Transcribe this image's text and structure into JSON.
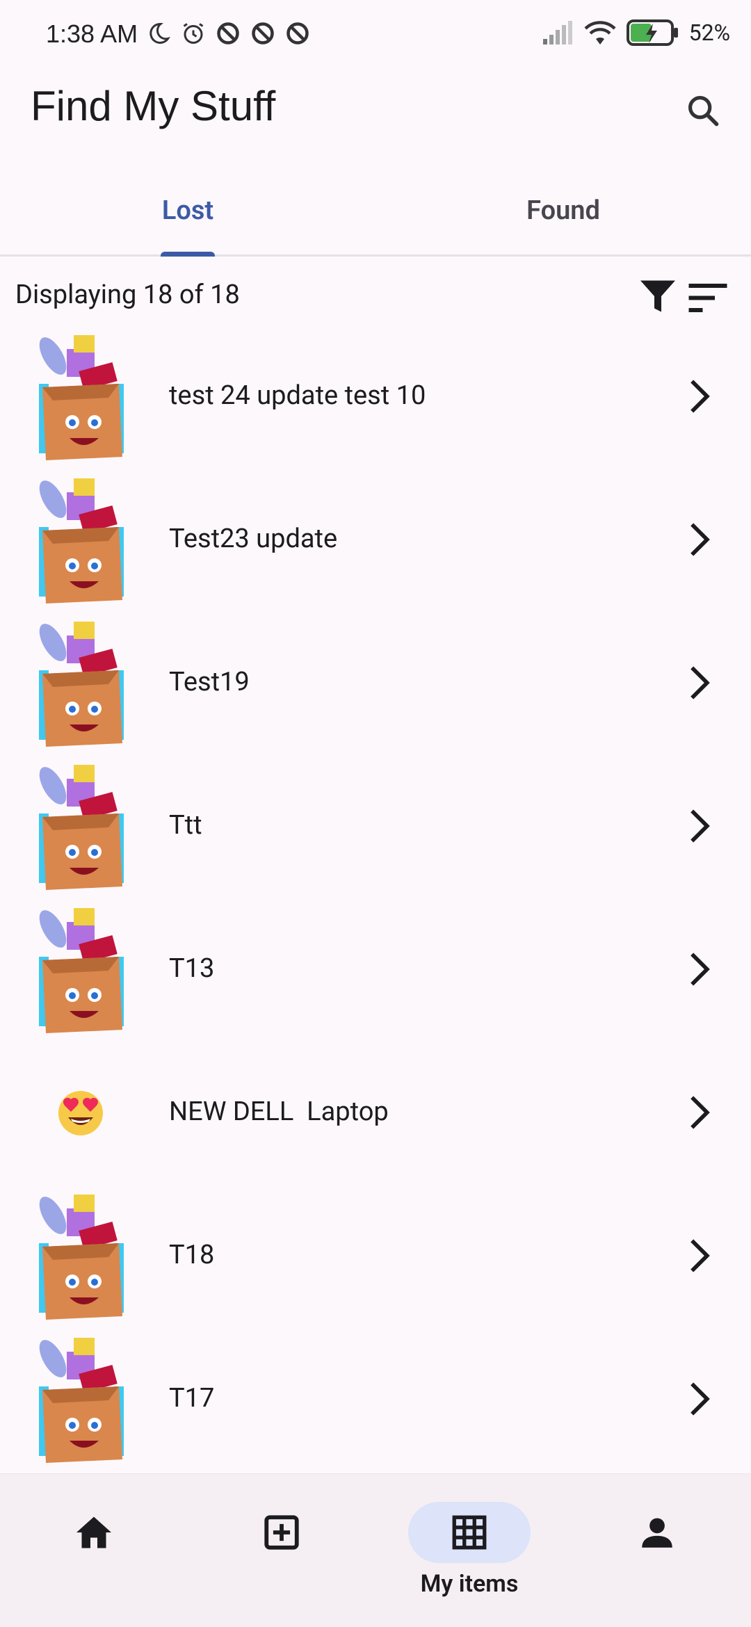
{
  "status_bar": {
    "time": "1:38 AM",
    "battery": "52%"
  },
  "app": {
    "title": "Find My Stuff"
  },
  "tabs": [
    {
      "label": "Lost",
      "active": true
    },
    {
      "label": "Found",
      "active": false
    }
  ],
  "toolbar": {
    "count_text": "Displaying 18 of 18"
  },
  "items": [
    {
      "label": "test 24 update test 10",
      "thumb": "cartoon-box-icon"
    },
    {
      "label": "Test23 update",
      "thumb": "cartoon-box-icon"
    },
    {
      "label": "Test19",
      "thumb": "cartoon-box-icon"
    },
    {
      "label": "Ttt",
      "thumb": "cartoon-box-icon"
    },
    {
      "label": "T13",
      "thumb": "cartoon-box-icon"
    },
    {
      "label": "NEW DELL  Laptop",
      "thumb": "heart-eyes-emoji-icon"
    },
    {
      "label": "T18",
      "thumb": "cartoon-box-icon"
    },
    {
      "label": "T17",
      "thumb": "cartoon-box-icon"
    }
  ],
  "bottom_nav": {
    "items": [
      {
        "icon": "home-icon",
        "label": ""
      },
      {
        "icon": "add-box-icon",
        "label": ""
      },
      {
        "icon": "grid-icon",
        "label": "My items",
        "active": true
      },
      {
        "icon": "person-icon",
        "label": ""
      }
    ]
  },
  "colors": {
    "accent": "#3d5aa7",
    "background": "#fdf8fb",
    "nav_active_pill": "#dde3f8"
  }
}
